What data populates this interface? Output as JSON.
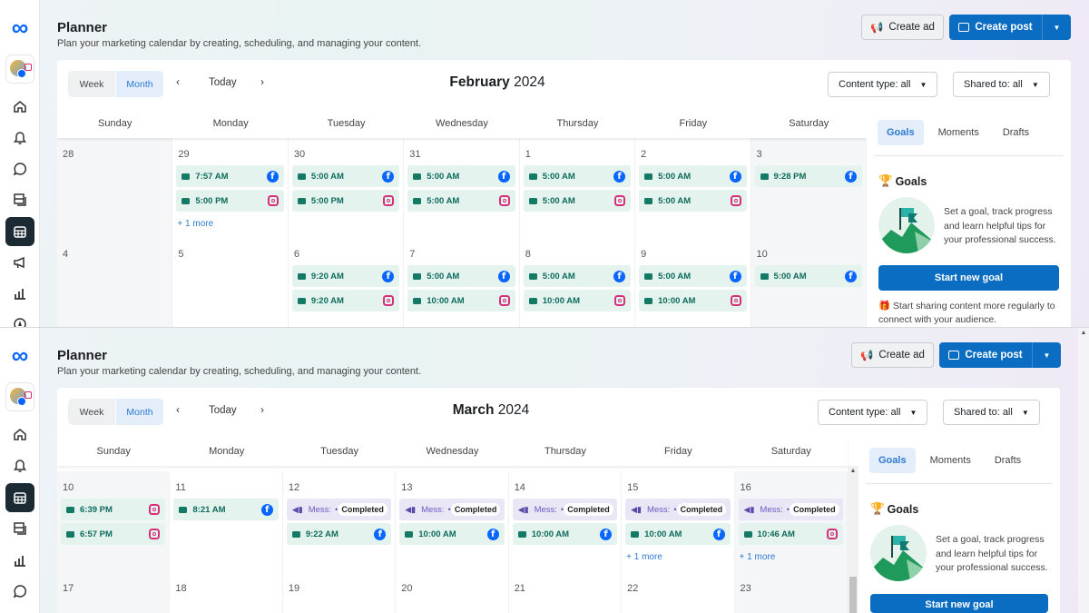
{
  "panels": [
    {
      "title": "Planner",
      "subtitle": "Plan your marketing calendar by creating, scheduling, and managing your content.",
      "create_ad": "Create ad",
      "create_post": "Create post",
      "view_week": "Week",
      "view_month": "Month",
      "today": "Today",
      "month_name": "February",
      "year": "2024",
      "content_filter": "Content type: all",
      "shared_filter": "Shared to: all",
      "days": [
        "Sunday",
        "Monday",
        "Tuesday",
        "Wednesday",
        "Thursday",
        "Friday",
        "Saturday"
      ],
      "tabs": [
        "Goals",
        "Moments",
        "Drafts"
      ],
      "goals_heading": "Goals",
      "goals_text": "Set a goal, track progress and learn helpful tips for your professional success.",
      "start_goal": "Start new goal",
      "share_tip": "Start sharing content more regularly to connect with your audience.",
      "weeks": [
        {
          "cells": [
            {
              "date": "28",
              "events": []
            },
            {
              "date": "29",
              "events": [
                {
                  "type": "post",
                  "time": "7:57 AM",
                  "platform": "facebook"
                },
                {
                  "type": "post",
                  "time": "5:00 PM",
                  "platform": "instagram"
                }
              ],
              "more": "+ 1 more"
            },
            {
              "date": "30",
              "events": [
                {
                  "type": "post",
                  "time": "5:00 AM",
                  "platform": "facebook"
                },
                {
                  "type": "post",
                  "time": "5:00 PM",
                  "platform": "instagram"
                }
              ]
            },
            {
              "date": "31",
              "events": [
                {
                  "type": "post",
                  "time": "5:00 AM",
                  "platform": "facebook"
                },
                {
                  "type": "post",
                  "time": "5:00 AM",
                  "platform": "instagram"
                }
              ]
            },
            {
              "date": "1",
              "events": [
                {
                  "type": "post",
                  "time": "5:00 AM",
                  "platform": "facebook"
                },
                {
                  "type": "post",
                  "time": "5:00 AM",
                  "platform": "instagram"
                }
              ]
            },
            {
              "date": "2",
              "events": [
                {
                  "type": "post",
                  "time": "5:00 AM",
                  "platform": "facebook"
                },
                {
                  "type": "post",
                  "time": "5:00 AM",
                  "platform": "instagram"
                }
              ]
            },
            {
              "date": "3",
              "events": [
                {
                  "type": "post",
                  "time": "9:28 PM",
                  "platform": "facebook"
                }
              ]
            }
          ]
        },
        {
          "cells": [
            {
              "date": "4",
              "events": []
            },
            {
              "date": "5",
              "events": []
            },
            {
              "date": "6",
              "events": [
                {
                  "type": "post",
                  "time": "9:20 AM",
                  "platform": "facebook"
                },
                {
                  "type": "post",
                  "time": "9:20 AM",
                  "platform": "instagram"
                }
              ]
            },
            {
              "date": "7",
              "events": [
                {
                  "type": "post",
                  "time": "5:00 AM",
                  "platform": "facebook"
                },
                {
                  "type": "post",
                  "time": "10:00 AM",
                  "platform": "instagram"
                }
              ]
            },
            {
              "date": "8",
              "events": [
                {
                  "type": "post",
                  "time": "5:00 AM",
                  "platform": "facebook"
                },
                {
                  "type": "post",
                  "time": "10:00 AM",
                  "platform": "instagram"
                }
              ]
            },
            {
              "date": "9",
              "events": [
                {
                  "type": "post",
                  "time": "5:00 AM",
                  "platform": "facebook"
                },
                {
                  "type": "post",
                  "time": "10:00 AM",
                  "platform": "instagram"
                }
              ]
            },
            {
              "date": "10",
              "events": [
                {
                  "type": "post",
                  "time": "5:00 AM",
                  "platform": "facebook"
                }
              ]
            }
          ]
        }
      ]
    },
    {
      "title": "Planner",
      "subtitle": "Plan your marketing calendar by creating, scheduling, and managing your content.",
      "create_ad": "Create ad",
      "create_post": "Create post",
      "view_week": "Week",
      "view_month": "Month",
      "today": "Today",
      "month_name": "March",
      "year": "2024",
      "content_filter": "Content type: all",
      "shared_filter": "Shared to: all",
      "days": [
        "Sunday",
        "Monday",
        "Tuesday",
        "Wednesday",
        "Thursday",
        "Friday",
        "Saturday"
      ],
      "tabs": [
        "Goals",
        "Moments",
        "Drafts"
      ],
      "goals_heading": "Goals",
      "goals_text": "Set a goal, track progress and learn helpful tips for your professional success.",
      "start_goal": "Start new goal",
      "weeks": [
        {
          "cells": [
            {
              "date": "10",
              "events": [
                {
                  "type": "post",
                  "time": "6:39 PM",
                  "platform": "instagram"
                },
                {
                  "type": "post",
                  "time": "6:57 PM",
                  "platform": "instagram"
                }
              ]
            },
            {
              "date": "11",
              "events": [
                {
                  "type": "post",
                  "time": "8:21 AM",
                  "platform": "facebook"
                }
              ]
            },
            {
              "date": "12",
              "events": [
                {
                  "type": "message",
                  "label": "Mess:",
                  "status": "Completed"
                },
                {
                  "type": "post",
                  "time": "9:22 AM",
                  "platform": "facebook"
                }
              ]
            },
            {
              "date": "13",
              "events": [
                {
                  "type": "message",
                  "label": "Mess:",
                  "status": "Completed"
                },
                {
                  "type": "post",
                  "time": "10:00 AM",
                  "platform": "facebook"
                }
              ]
            },
            {
              "date": "14",
              "events": [
                {
                  "type": "message",
                  "label": "Mess:",
                  "status": "Completed"
                },
                {
                  "type": "post",
                  "time": "10:00 AM",
                  "platform": "facebook"
                }
              ]
            },
            {
              "date": "15",
              "events": [
                {
                  "type": "message",
                  "label": "Mess:",
                  "status": "Completed"
                },
                {
                  "type": "post",
                  "time": "10:00 AM",
                  "platform": "facebook"
                }
              ],
              "more": "+ 1 more"
            },
            {
              "date": "16",
              "events": [
                {
                  "type": "message",
                  "label": "Mess:",
                  "status": "Completed"
                },
                {
                  "type": "post",
                  "time": "10:46 AM",
                  "platform": "instagram"
                }
              ],
              "more": "+ 1 more"
            }
          ]
        },
        {
          "cells": [
            {
              "date": "17",
              "events": []
            },
            {
              "date": "18",
              "events": []
            },
            {
              "date": "19",
              "events": []
            },
            {
              "date": "20",
              "events": []
            },
            {
              "date": "21",
              "events": []
            },
            {
              "date": "22",
              "events": []
            },
            {
              "date": "23",
              "events": []
            }
          ]
        }
      ]
    }
  ],
  "colors": {
    "primary": "#0a6dc2",
    "post_bg": "#e4f3ee",
    "message_bg": "#e9e6f6",
    "sidebar_active": "#1c2b33"
  }
}
